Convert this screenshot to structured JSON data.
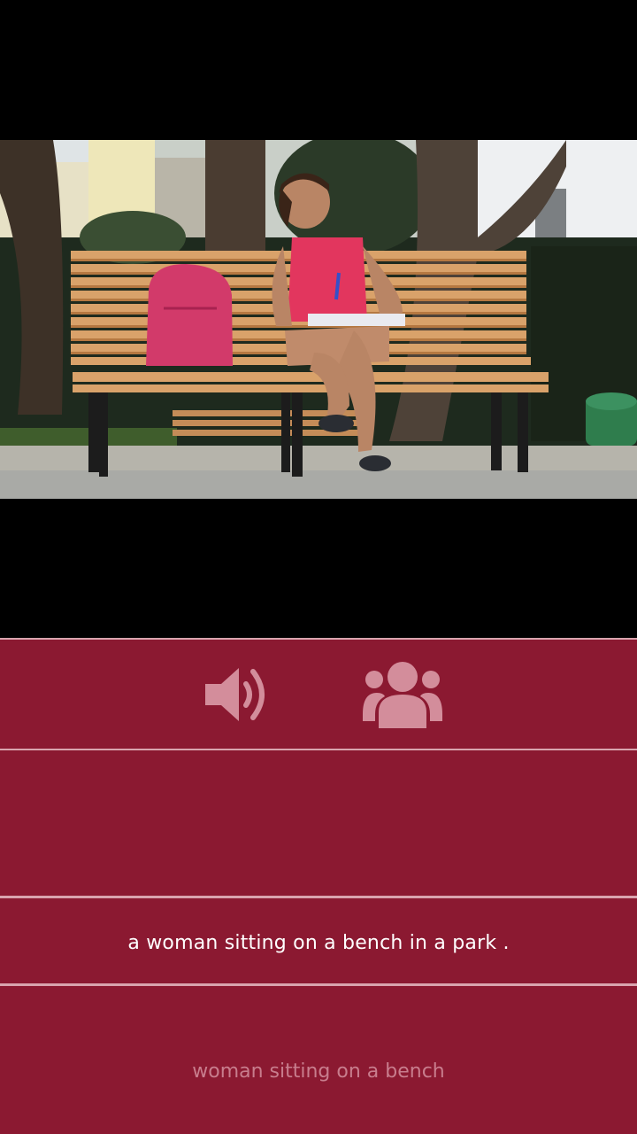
{
  "photo": {
    "alt": "Woman in a pink tank top sitting on a wooden park bench writing in a notebook, pink backpack beside her"
  },
  "controls": {
    "speaker_icon": "speaker-icon",
    "people_icon": "people-icon"
  },
  "caption": {
    "text": "a woman sitting on a bench in a park ."
  },
  "hint": {
    "text": "woman sitting on a bench"
  },
  "colors": {
    "panel": "#8b1931",
    "divider": "#d9a4ae",
    "icon": "#d38d9b",
    "caption_text": "#ffffff",
    "hint_text": "#c87d8d"
  }
}
